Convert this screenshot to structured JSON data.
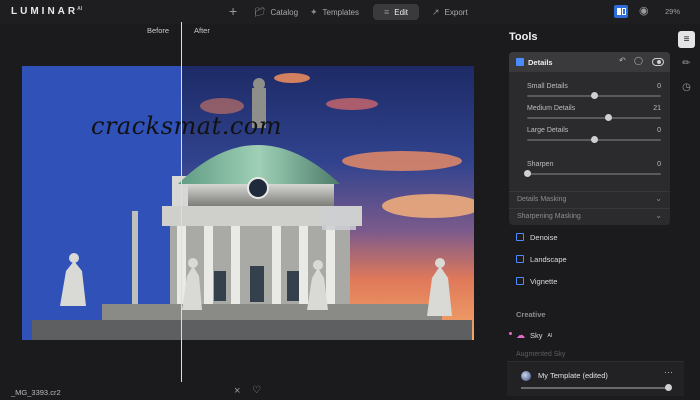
{
  "app": {
    "logo": "LUMINAR",
    "logo_superscript": "AI"
  },
  "topbar": {
    "add_label": "+",
    "nav": [
      {
        "label": "Catalog",
        "icon": "folder-icon"
      },
      {
        "label": "Templates",
        "icon": "magic-wand-icon"
      },
      {
        "label": "Edit",
        "icon": "sliders-icon",
        "active": true
      },
      {
        "label": "Export",
        "icon": "export-icon"
      }
    ],
    "zoom": "29%"
  },
  "canvas": {
    "before_label": "Before",
    "after_label": "After",
    "watermark": "cracksmat.com",
    "filename": "_MG_3393.cr2"
  },
  "panel": {
    "title": "Tools",
    "details": {
      "title": "Details",
      "sliders": [
        {
          "label": "Small Details",
          "value": "0",
          "level": 0
        },
        {
          "label": "Medium Details",
          "value": "21",
          "level": 21
        },
        {
          "label": "Large Details",
          "value": "0",
          "level": 0
        },
        {
          "label": "Sharpen",
          "value": "0",
          "level": 0,
          "min_start": true
        }
      ],
      "sections": [
        "Details Masking",
        "Sharpening Masking"
      ]
    },
    "tools": [
      {
        "label": "Denoise",
        "icon": "denoise-icon"
      },
      {
        "label": "Landscape",
        "icon": "landscape-icon"
      },
      {
        "label": "Vignette",
        "icon": "vignette-icon"
      }
    ],
    "creative_title": "Creative",
    "sky_label": "Sky",
    "sky_suffix": "AI",
    "augmented_label": "Augmented Sky",
    "template": {
      "name": "My Template (edited)",
      "more": "···",
      "amount": 100
    }
  },
  "colors": {
    "accent": "#2f6cd6",
    "sky_pink": "#e46ac9",
    "panel_bg": "#2b2b2e"
  }
}
